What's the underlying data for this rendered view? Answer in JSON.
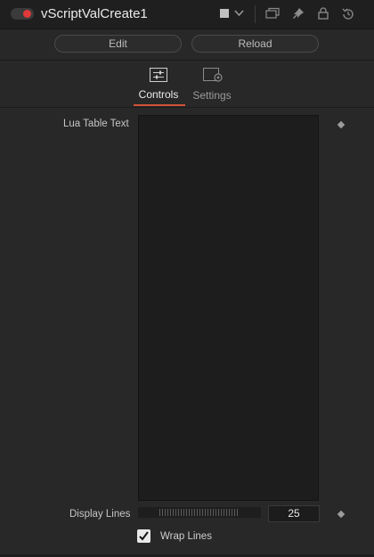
{
  "header": {
    "node_name": "vScriptValCreate1",
    "enabled": true,
    "icons": [
      "color-swatch-icon",
      "chevron-down-icon",
      "versions-icon",
      "pin-icon",
      "lock-icon",
      "reset-icon"
    ]
  },
  "actions": {
    "edit_label": "Edit",
    "reload_label": "Reload"
  },
  "tabs": [
    {
      "label": "Controls",
      "icon": "sliders-icon",
      "active": true
    },
    {
      "label": "Settings",
      "icon": "settings-icon",
      "active": false
    }
  ],
  "controls": {
    "lua_table_text": {
      "label": "Lua Table Text",
      "value": ""
    },
    "display_lines": {
      "label": "Display Lines",
      "value": "25"
    },
    "wrap_lines": {
      "label": "Wrap Lines",
      "checked": true
    }
  },
  "colors": {
    "accent": "#d2513b",
    "toggle_on": "#e0393a"
  }
}
